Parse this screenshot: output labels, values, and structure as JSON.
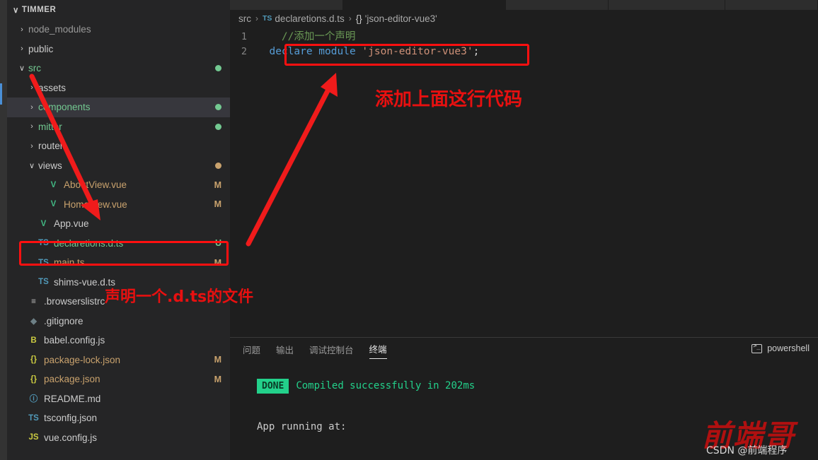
{
  "window": {
    "background": "#1e1e1e",
    "sidebar_background": "#252526",
    "accent_red": "#ff1010"
  },
  "activity_bar": {
    "indicator_color": "#4a8fd6"
  },
  "explorer": {
    "root_label": "TIMMER",
    "root_twisty": "∨",
    "items": [
      {
        "label": "node_modules",
        "indent": 14,
        "twisty": "›",
        "icon": "",
        "icon_color": "",
        "text_color": "#9a9a9a",
        "status": "",
        "status_color": "",
        "dot": ""
      },
      {
        "label": "public",
        "indent": 14,
        "twisty": "›",
        "icon": "",
        "icon_color": "",
        "text_color": "#cccccc",
        "status": "",
        "status_color": "",
        "dot": ""
      },
      {
        "label": "src",
        "indent": 14,
        "twisty": "∨",
        "icon": "",
        "icon_color": "",
        "text_color": "#73c991",
        "status": "",
        "status_color": "",
        "dot": "#73c991"
      },
      {
        "label": "assets",
        "indent": 28,
        "twisty": "›",
        "icon": "",
        "icon_color": "",
        "text_color": "#cccccc",
        "status": "",
        "status_color": "",
        "dot": ""
      },
      {
        "label": "components",
        "indent": 28,
        "twisty": "›",
        "icon": "",
        "icon_color": "",
        "text_color": "#73c991",
        "status": "",
        "status_color": "",
        "dot": "#73c991",
        "selected": true
      },
      {
        "label": "mitter",
        "indent": 28,
        "twisty": "›",
        "icon": "",
        "icon_color": "",
        "text_color": "#73c991",
        "status": "",
        "status_color": "",
        "dot": "#73c991"
      },
      {
        "label": "router",
        "indent": 28,
        "twisty": "›",
        "icon": "",
        "icon_color": "",
        "text_color": "#cccccc",
        "status": "",
        "status_color": "",
        "dot": ""
      },
      {
        "label": "views",
        "indent": 28,
        "twisty": "∨",
        "icon": "",
        "icon_color": "",
        "text_color": "#cccccc",
        "status": "",
        "status_color": "",
        "dot": "#c9a26d"
      },
      {
        "label": "AboutView.vue",
        "indent": 42,
        "twisty": "",
        "icon": "V",
        "icon_color": "#41b883",
        "text_color": "#c9a26d",
        "status": "M",
        "status_color": "#c9a26d",
        "dot": ""
      },
      {
        "label": "HomeView.vue",
        "indent": 42,
        "twisty": "",
        "icon": "V",
        "icon_color": "#41b883",
        "text_color": "#c9a26d",
        "status": "M",
        "status_color": "#c9a26d",
        "dot": ""
      },
      {
        "label": "App.vue",
        "indent": 28,
        "twisty": "",
        "icon": "V",
        "icon_color": "#41b883",
        "text_color": "#cccccc",
        "status": "",
        "status_color": "",
        "dot": ""
      },
      {
        "label": "declaretions.d.ts",
        "indent": 28,
        "twisty": "",
        "icon": "TS",
        "icon_color": "#519aba",
        "text_color": "#73c991",
        "status": "U",
        "status_color": "#73c991",
        "dot": ""
      },
      {
        "label": "main.ts",
        "indent": 28,
        "twisty": "",
        "icon": "TS",
        "icon_color": "#519aba",
        "text_color": "#c9a26d",
        "status": "M",
        "status_color": "#c9a26d",
        "dot": ""
      },
      {
        "label": "shims-vue.d.ts",
        "indent": 28,
        "twisty": "",
        "icon": "TS",
        "icon_color": "#519aba",
        "text_color": "#cccccc",
        "status": "",
        "status_color": "",
        "dot": ""
      },
      {
        "label": ".browserslistrc",
        "indent": 14,
        "twisty": "",
        "icon": "≡",
        "icon_color": "#cfcfcf",
        "text_color": "#cccccc",
        "status": "",
        "status_color": "",
        "dot": ""
      },
      {
        "label": ".gitignore",
        "indent": 14,
        "twisty": "",
        "icon": "◆",
        "icon_color": "#6d8086",
        "text_color": "#cccccc",
        "status": "",
        "status_color": "",
        "dot": ""
      },
      {
        "label": "babel.config.js",
        "indent": 14,
        "twisty": "",
        "icon": "B",
        "icon_color": "#cbcb41",
        "text_color": "#cccccc",
        "status": "",
        "status_color": "",
        "dot": ""
      },
      {
        "label": "package-lock.json",
        "indent": 14,
        "twisty": "",
        "icon": "{}",
        "icon_color": "#cbcb41",
        "text_color": "#c9a26d",
        "status": "M",
        "status_color": "#c9a26d",
        "dot": ""
      },
      {
        "label": "package.json",
        "indent": 14,
        "twisty": "",
        "icon": "{}",
        "icon_color": "#cbcb41",
        "text_color": "#c9a26d",
        "status": "M",
        "status_color": "#c9a26d",
        "dot": ""
      },
      {
        "label": "README.md",
        "indent": 14,
        "twisty": "",
        "icon": "ⓘ",
        "icon_color": "#519aba",
        "text_color": "#cccccc",
        "status": "",
        "status_color": "",
        "dot": ""
      },
      {
        "label": "tsconfig.json",
        "indent": 14,
        "twisty": "",
        "icon": "TS",
        "icon_color": "#519aba",
        "text_color": "#cccccc",
        "status": "",
        "status_color": "",
        "dot": ""
      },
      {
        "label": "vue.config.js",
        "indent": 14,
        "twisty": "",
        "icon": "JS",
        "icon_color": "#cbcb41",
        "text_color": "#cccccc",
        "status": "",
        "status_color": "",
        "dot": ""
      }
    ]
  },
  "editor": {
    "breadcrumb": {
      "folder": "src",
      "file_icon": "TS",
      "file": "declaretions.d.ts",
      "symbol_icon": "{}",
      "symbol": "'json-editor-vue3'",
      "separator": "›"
    },
    "lines": [
      {
        "number": "1",
        "tokens": [
          {
            "text": "    //添加一个声明",
            "type": "comment"
          }
        ]
      },
      {
        "number": "2",
        "tokens": [
          {
            "text": "  ",
            "type": "plain"
          },
          {
            "text": "declare module",
            "type": "keyword"
          },
          {
            "text": " ",
            "type": "plain"
          },
          {
            "text": "'json-editor-vue3'",
            "type": "string"
          },
          {
            "text": ";",
            "type": "plain"
          }
        ]
      }
    ]
  },
  "panel": {
    "tabs": [
      {
        "label": "问题",
        "active": false
      },
      {
        "label": "输出",
        "active": false
      },
      {
        "label": "调试控制台",
        "active": false
      },
      {
        "label": "终端",
        "active": true
      }
    ],
    "shell_label": "powershell",
    "shell_icon": "terminal-icon",
    "terminal": {
      "badge": "DONE",
      "badge_color": "#23d18b",
      "compiled_message": "Compiled successfully in 202ms",
      "running_message": "App running at:"
    }
  },
  "annotations": {
    "code_note": "添加上面这行代码",
    "file_note": "声明一个.d.ts的文件",
    "box_color": "#ff1010",
    "arrow_color": "#f01b1b"
  },
  "watermark": {
    "big_text": "前端哥",
    "small_text": "CSDN @前端程序"
  }
}
